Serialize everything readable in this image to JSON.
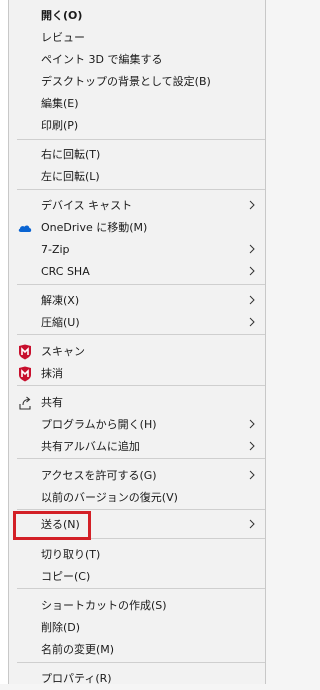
{
  "menu": {
    "items": [
      {
        "label": "開く(O)",
        "bold": true,
        "arrow": false,
        "icon": ""
      },
      {
        "label": "レビュー",
        "bold": false,
        "arrow": false,
        "icon": ""
      },
      {
        "label": "ペイント 3D で編集する",
        "bold": false,
        "arrow": false,
        "icon": ""
      },
      {
        "label": "デスクトップの背景として設定(B)",
        "bold": false,
        "arrow": false,
        "icon": ""
      },
      {
        "label": "編集(E)",
        "bold": false,
        "arrow": false,
        "icon": ""
      },
      {
        "label": "印刷(P)",
        "bold": false,
        "arrow": false,
        "icon": ""
      },
      {
        "label": "右に回転(T)",
        "bold": false,
        "arrow": false,
        "icon": ""
      },
      {
        "label": "左に回転(L)",
        "bold": false,
        "arrow": false,
        "icon": ""
      },
      {
        "label": "デバイス キャスト",
        "bold": false,
        "arrow": true,
        "icon": ""
      },
      {
        "label": "OneDrive に移動(M)",
        "bold": false,
        "arrow": false,
        "icon": "onedrive-cloud-icon"
      },
      {
        "label": "7-Zip",
        "bold": false,
        "arrow": true,
        "icon": ""
      },
      {
        "label": "CRC SHA",
        "bold": false,
        "arrow": true,
        "icon": ""
      },
      {
        "label": "解凍(X)",
        "bold": false,
        "arrow": true,
        "icon": ""
      },
      {
        "label": "圧縮(U)",
        "bold": false,
        "arrow": true,
        "icon": ""
      },
      {
        "label": "スキャン",
        "bold": false,
        "arrow": false,
        "icon": "mcafee-shield-icon"
      },
      {
        "label": "抹消",
        "bold": false,
        "arrow": false,
        "icon": "mcafee-shield-icon"
      },
      {
        "label": "共有",
        "bold": false,
        "arrow": false,
        "icon": "share-icon"
      },
      {
        "label": "プログラムから開く(H)",
        "bold": false,
        "arrow": true,
        "icon": ""
      },
      {
        "label": "共有アルバムに追加",
        "bold": false,
        "arrow": true,
        "icon": ""
      },
      {
        "label": "アクセスを許可する(G)",
        "bold": false,
        "arrow": true,
        "icon": ""
      },
      {
        "label": "以前のバージョンの復元(V)",
        "bold": false,
        "arrow": false,
        "icon": ""
      },
      {
        "label": "送る(N)",
        "bold": false,
        "arrow": true,
        "icon": ""
      },
      {
        "label": "切り取り(T)",
        "bold": false,
        "arrow": false,
        "icon": ""
      },
      {
        "label": "コピー(C)",
        "bold": false,
        "arrow": false,
        "icon": ""
      },
      {
        "label": "ショートカットの作成(S)",
        "bold": false,
        "arrow": false,
        "icon": ""
      },
      {
        "label": "削除(D)",
        "bold": false,
        "arrow": false,
        "icon": ""
      },
      {
        "label": "名前の変更(M)",
        "bold": false,
        "arrow": false,
        "icon": ""
      },
      {
        "label": "プロパティ(R)",
        "bold": false,
        "arrow": false,
        "icon": ""
      }
    ]
  },
  "colors": {
    "menu_bg": "#f2f2f2",
    "separator": "#cfcfcf",
    "highlight_border": "#d32027",
    "onedrive_blue": "#0a64d2",
    "mcafee_red": "#c8102e"
  }
}
